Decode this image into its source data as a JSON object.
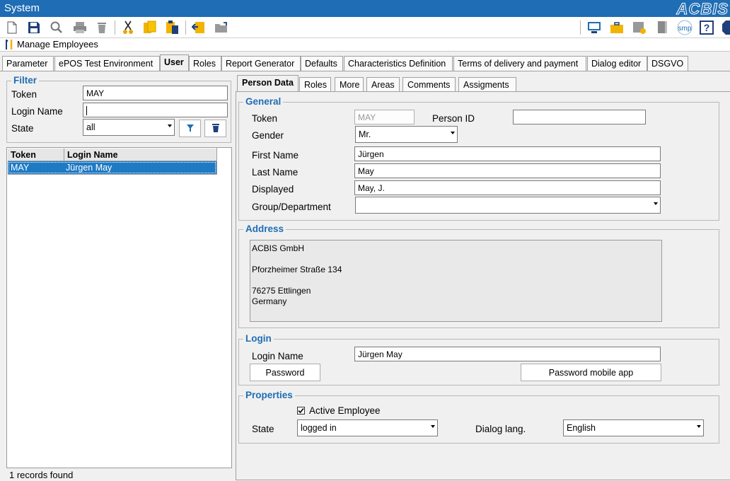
{
  "window": {
    "title": "System",
    "logo": "ACBIS"
  },
  "toolbar": {
    "left_icons": [
      "new-document-icon",
      "save-icon",
      "search-icon",
      "print-icon",
      "delete-icon",
      "cut-icon",
      "copy-icon",
      "paste-icon",
      "import-icon",
      "open-folder-icon"
    ],
    "right_icons": [
      "monitor-icon",
      "briefcase-icon",
      "settings-folder-icon",
      "bookmark-icon",
      "smp-icon",
      "help-icon",
      "info-icon"
    ],
    "smp_label": "smp",
    "help_label": "?"
  },
  "module": {
    "title": "Manage Employees"
  },
  "main_tabs": [
    "Parameter",
    "ePOS Test Environment",
    "User",
    "Roles",
    "Report Generator",
    "Defaults",
    "Characteristics Definition",
    "Terms of delivery and payment",
    "Dialog editor",
    "DSGVO"
  ],
  "filter": {
    "legend": "Filter",
    "token_label": "Token",
    "token_value": "MAY",
    "login_label": "Login Name",
    "login_value": "",
    "state_label": "State",
    "state_value": "all"
  },
  "results": {
    "columns": [
      "Token",
      "Login Name"
    ],
    "rows": [
      {
        "token": "MAY",
        "login": "Jürgen May"
      }
    ],
    "status": "1 records found"
  },
  "person_tabs": [
    "Person Data",
    "Roles",
    "More",
    "Areas",
    "Comments",
    "Assigments"
  ],
  "general": {
    "legend": "General",
    "token_label": "Token",
    "token_value": "MAY",
    "person_id_label": "Person ID",
    "person_id_value": "",
    "gender_label": "Gender",
    "gender_value": "Mr.",
    "first_name_label": "First Name",
    "first_name_value": "Jürgen",
    "last_name_label": "Last Name",
    "last_name_value": "May",
    "displayed_label": "Displayed",
    "displayed_value": "May, J.",
    "group_label": "Group/Department",
    "group_value": ""
  },
  "address": {
    "legend": "Address",
    "lines": [
      "ACBIS GmbH",
      "",
      "Pforzheimer Straße 134",
      "",
      "76275 Ettlingen",
      "Germany"
    ]
  },
  "login": {
    "legend": "Login",
    "login_label": "Login Name",
    "login_value": "Jürgen May",
    "password_button": "Password",
    "password_mobile_button": "Password mobile app"
  },
  "properties": {
    "legend": "Properties",
    "active_label": "Active Employee",
    "active_checked": true,
    "state_label": "State",
    "state_value": "logged in",
    "dialog_lang_label": "Dialog lang.",
    "dialog_lang_value": "English"
  },
  "colors": {
    "titlebar": "#1f6db4",
    "accent": "#1f6db4",
    "selection": "#1f7ac4"
  }
}
